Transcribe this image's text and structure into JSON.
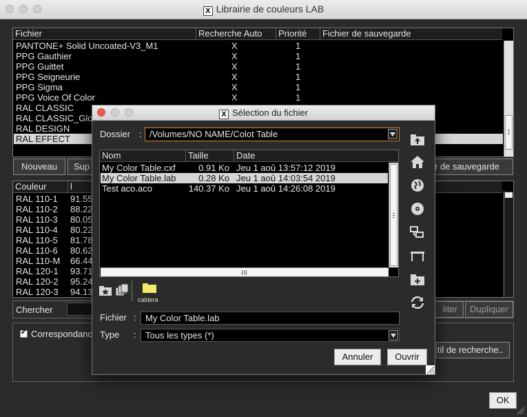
{
  "window": {
    "title": "Librairie de couleurs LAB",
    "ok_label": "OK"
  },
  "files_table": {
    "headers": [
      "Fichier",
      "Recherche Auto",
      "Priorité",
      "Fichier de sauvegarde"
    ],
    "rows": [
      {
        "file": "PANTONE+ Solid Uncoated-V3_M1",
        "auto": "X",
        "prio": "1"
      },
      {
        "file": "PPG Gauthier",
        "auto": "X",
        "prio": "1"
      },
      {
        "file": "PPG Guittet",
        "auto": "X",
        "prio": "1"
      },
      {
        "file": "PPG Seigneurie",
        "auto": "X",
        "prio": "1"
      },
      {
        "file": "PPG Sigma",
        "auto": "X",
        "prio": "1"
      },
      {
        "file": "PPG Voice Of Color",
        "auto": "X",
        "prio": "1"
      },
      {
        "file": "RAL CLASSIC",
        "auto": "",
        "prio": ""
      },
      {
        "file": "RAL CLASSIC_Glo",
        "auto": "",
        "prio": ""
      },
      {
        "file": "RAL DESIGN",
        "auto": "",
        "prio": ""
      },
      {
        "file": "RAL EFFECT",
        "auto": "",
        "prio": ""
      }
    ]
  },
  "buttons_row1": {
    "nouveau": "Nouveau",
    "supprimer": "Sup",
    "sauvegarde": "r de sauvegarde"
  },
  "colors_table": {
    "headers": [
      "Couleur",
      "l"
    ],
    "rows": [
      {
        "name": "RAL 110-1",
        "l": "91.55"
      },
      {
        "name": "RAL 110-2",
        "l": "88.22"
      },
      {
        "name": "RAL 110-3",
        "l": "80.05"
      },
      {
        "name": "RAL 110-4",
        "l": "80.22"
      },
      {
        "name": "RAL 110-5",
        "l": "81.78"
      },
      {
        "name": "RAL 110-6",
        "l": "80.62"
      },
      {
        "name": "RAL 110-M",
        "l": "66.44"
      },
      {
        "name": "RAL 120-1",
        "l": "93.71"
      },
      {
        "name": "RAL 120-2",
        "l": "95.24"
      },
      {
        "name": "RAL 120-3",
        "l": "94.13"
      }
    ]
  },
  "search": {
    "label": "Chercher",
    "colon": ":"
  },
  "buttons_row2": {
    "editer": "liter",
    "dupliquer": "Dupliquer"
  },
  "correspondance": {
    "label": "Correspondanc",
    "tool_button": "til de recherche.."
  },
  "dialog": {
    "title": "Sélection du fichier",
    "folder_label": "Dossier",
    "folder_value": "/Volumes/NO NAME/Colot Table",
    "list_headers": [
      "Nom",
      "Taille",
      "Date"
    ],
    "files": [
      {
        "name": "My Color Table.cxf",
        "size": "0.91 Ko",
        "date": "Jeu  1 aoû 13:57:12 2019"
      },
      {
        "name": "My Color Table.lab",
        "size": "0.28 Ko",
        "date": "Jeu  1 aoû 14:03:54 2019"
      },
      {
        "name": "Test aco.aco",
        "size": "140.37 Ko",
        "date": "Jeu  1 aoû 14:26:08 2019"
      }
    ],
    "favorite_label": "caldera",
    "file_label": "Fichier",
    "file_value": "My Color Table.lab",
    "type_label": "Type",
    "type_value": "Tous les types (*)",
    "cancel": "Annuler",
    "open": "Ouvrir",
    "colon": ":"
  }
}
